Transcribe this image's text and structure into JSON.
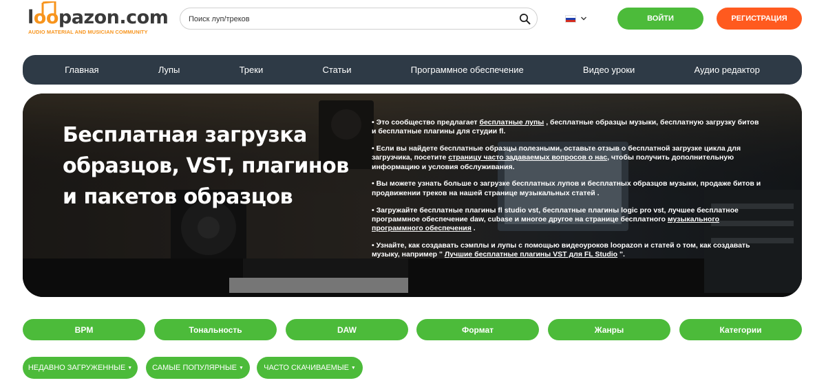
{
  "header": {
    "logo_text_prefix": "l",
    "logo_text_o": "oo",
    "logo_text_rest": "pazon.com",
    "logo_tagline": "AUDIO MATERIAL AND MUSICIAN COMMUNITY",
    "search_placeholder": "Поиск луп/треков",
    "language": "ru",
    "login_label": "ВОЙТИ",
    "register_label": "РЕГИСТРАЦИЯ"
  },
  "colors": {
    "accent_green": "#4cbb3a",
    "accent_orange": "#ff5a1f",
    "brand_orange": "#f7941d",
    "nav_bg": "#2e3a46"
  },
  "nav": {
    "items": [
      {
        "label": "Главная"
      },
      {
        "label": "Лупы"
      },
      {
        "label": "Треки"
      },
      {
        "label": "Статьи"
      },
      {
        "label": "Программное обеспечение"
      },
      {
        "label": "Видео уроки"
      },
      {
        "label": "Аудио редактор"
      }
    ]
  },
  "hero": {
    "title": "Бесплатная загрузка образцов, VST, плагинов и пакетов образцов",
    "bullets": [
      {
        "before": "• Это сообщество предлагает ",
        "link": "бесплатные лупы",
        "after": " , бесплатные образцы музыки, бесплатную загрузку битов и бесплатные плагины для студии fl."
      },
      {
        "before": "• Если вы найдете бесплатные образцы полезными, оставьте отзыв о бесплатной загрузке цикла для загрузчика, посетите ",
        "link": "страницу часто задаваемых вопросов о нас",
        "after": ", чтобы получить дополнительную информацию и условия обслуживания."
      },
      {
        "before": "• Вы можете узнать больше о загрузке бесплатных лупов и бесплатных образцов музыки, продаже битов и продвижении треков на нашей странице музыкальных статей .",
        "link": "",
        "after": ""
      },
      {
        "before": "• Загружайте бесплатные плагины fl studio vst, бесплатные плагины logic pro vst, лучшее бесплатное программное обеспечение daw, cubase и многое другое на странице бесплатного ",
        "link": "музыкального программного обеспечения",
        "after": " ."
      },
      {
        "before": "• Узнайте, как создавать сэмплы и лупы с помощью видеоуроков loopazon и статей о том, как создавать музыку, например \" ",
        "link": "Лучшие бесплатные плагины VST для FL Studio",
        "after": " \"."
      }
    ]
  },
  "filters": [
    {
      "label": "BPM"
    },
    {
      "label": "Тональность"
    },
    {
      "label": "DAW"
    },
    {
      "label": "Формат"
    },
    {
      "label": "Жанры"
    },
    {
      "label": "Категории"
    }
  ],
  "sorts": [
    {
      "label": "НЕДАВНО ЗАГРУЖЕННЫЕ"
    },
    {
      "label": "САМЫЕ ПОПУЛЯРНЫЕ"
    },
    {
      "label": "ЧАСТО СКАЧИВАЕМЫЕ"
    }
  ],
  "icons": {
    "search": "search-icon",
    "flag": "russia-flag-icon",
    "chevron": "chevron-down-icon",
    "caret": "caret-down-icon",
    "logo_note": "music-note-icon"
  }
}
